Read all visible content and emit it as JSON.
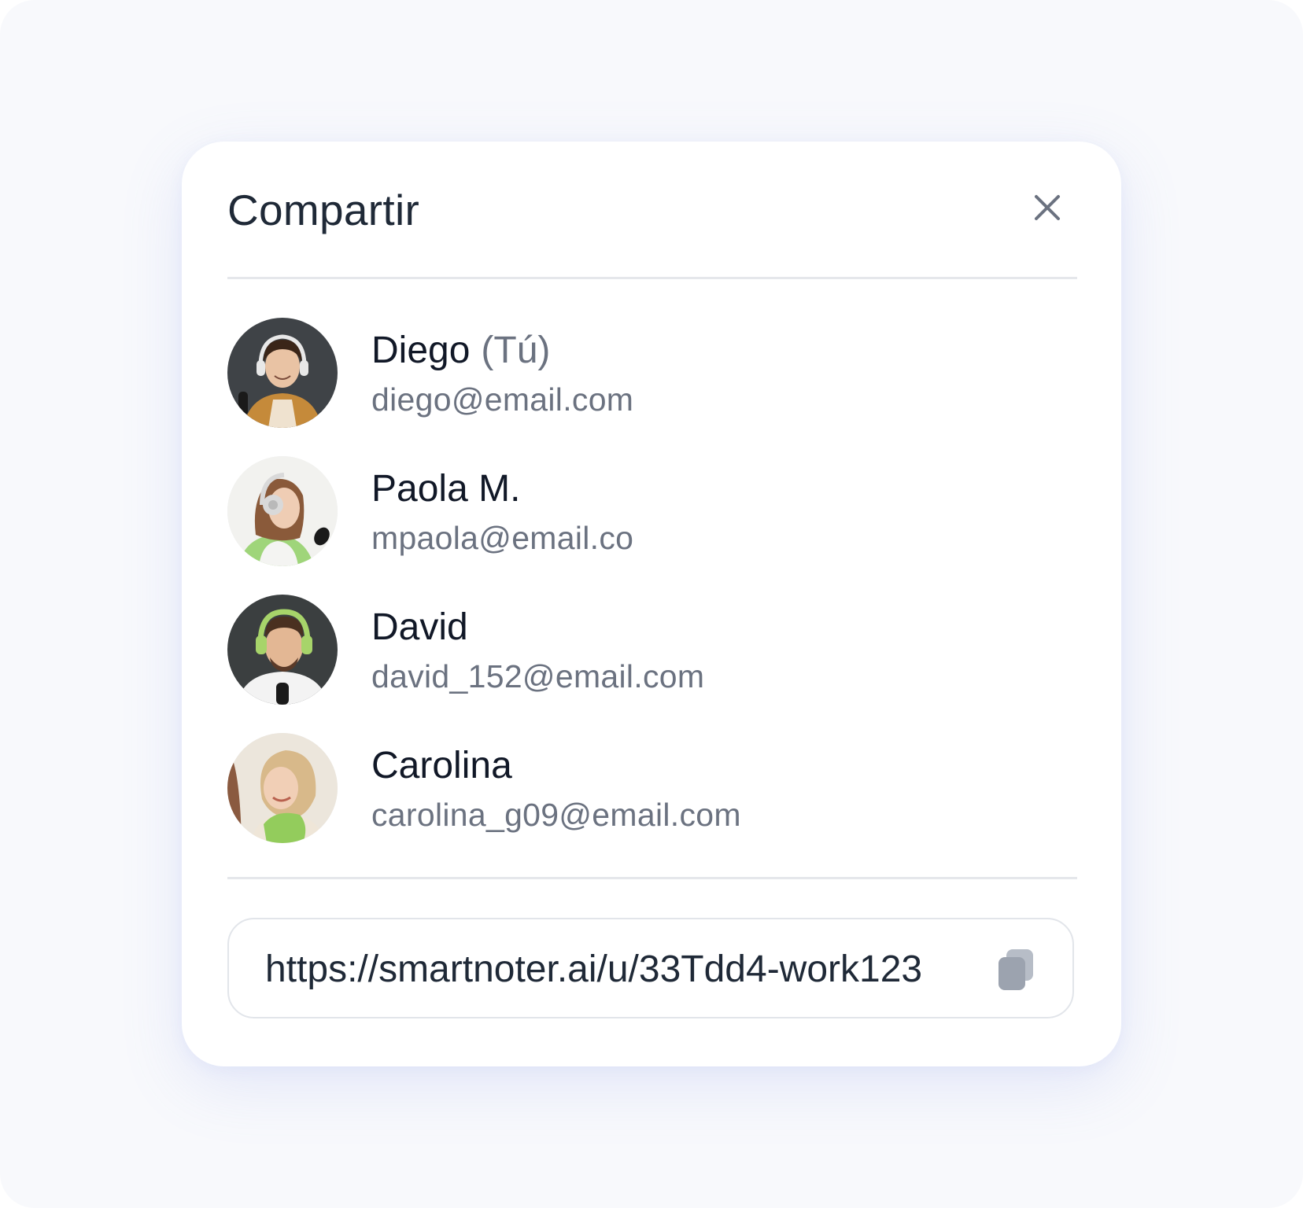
{
  "dialog": {
    "title": "Compartir",
    "close_icon": "close-icon"
  },
  "people": [
    {
      "name": "Diego",
      "tag": "(Tú)",
      "email": "diego@email.com",
      "avatar_bg": "#3f4347",
      "shirt": "#c58a3a",
      "hair": "#3a2518",
      "headphones": "#e8e8e8"
    },
    {
      "name": "Paola M.",
      "tag": "",
      "email": "mpaola@email.co",
      "avatar_bg": "#f2f2ef",
      "shirt": "#9fd57a",
      "hair": "#8a5a3a",
      "headphones": "#d9d9d9"
    },
    {
      "name": "David",
      "tag": "",
      "email": "david_152@email.com",
      "avatar_bg": "#3b3f40",
      "shirt": "#f3f3f3",
      "hair": "#4a3020",
      "headphones": "#a7d46a"
    },
    {
      "name": "Carolina",
      "tag": "",
      "email": "carolina_g09@email.com",
      "avatar_bg": "#ece6dc",
      "shirt": "#efe6d8",
      "hair": "#d8b98a",
      "headphones": "#93cc5c"
    }
  ],
  "share_link": {
    "url": "https://smartnoter.ai/u/33Tdd4-work123",
    "copy_icon": "copy-icon"
  },
  "colors": {
    "title": "#1f2937",
    "muted": "#6b7280",
    "icon": "#6b7280",
    "divider": "#e5e7eb"
  }
}
